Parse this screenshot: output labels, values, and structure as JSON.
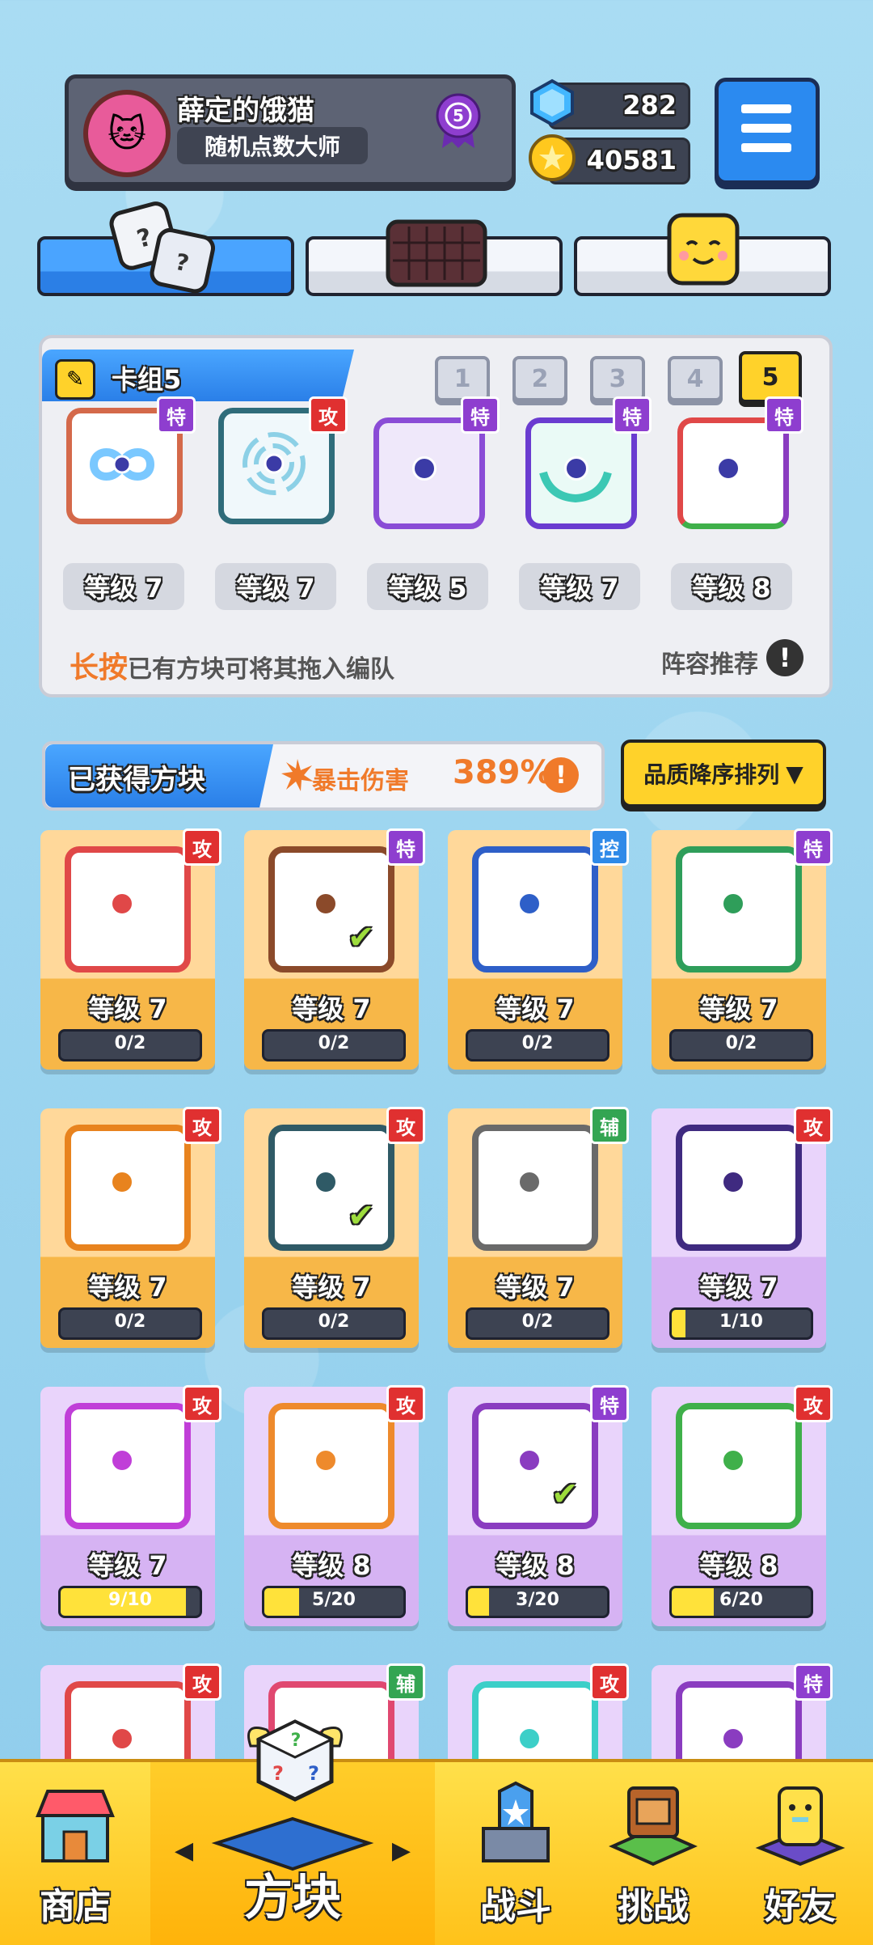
{
  "profile": {
    "username": "薛定的饿猫",
    "title": "随机点数大师",
    "rank": "5"
  },
  "currency": {
    "gems": "282",
    "coins": "40581"
  },
  "top_tabs": [
    {
      "id": "dice",
      "active": true
    },
    {
      "id": "board",
      "active": false
    },
    {
      "id": "emote",
      "active": false
    }
  ],
  "deck": {
    "title": "卡组5",
    "numbers": [
      "1",
      "2",
      "3",
      "4",
      "5"
    ],
    "active_number": "5",
    "slots": [
      {
        "tag": "特",
        "level": "等级 7",
        "icon": "rainbow-infinity-dice"
      },
      {
        "tag": "攻",
        "level": "等级 7",
        "icon": "vortex-dice"
      },
      {
        "tag": "特",
        "level": "等级 5",
        "icon": "crack-dice"
      },
      {
        "tag": "特",
        "level": "等级 7",
        "icon": "hands-dice"
      },
      {
        "tag": "特",
        "level": "等级 8",
        "icon": "rainbow-prism-dice"
      }
    ],
    "hint_highlight": "长按",
    "hint_rest": "已有方块可将其拖入编队",
    "recommend_label": "阵容推荐"
  },
  "obtained": {
    "title": "已获得方块",
    "crit_label": "暴击伤害",
    "crit_value": "389%",
    "sort_label": "品质降序排列"
  },
  "cards": [
    {
      "tag": "攻",
      "tag_type": "gong",
      "level": "等级 7",
      "progress": "0/2",
      "fill": 0,
      "rarity": "gold",
      "icon": "star-burst-dice",
      "color": "#e04848",
      "checked": false
    },
    {
      "tag": "特",
      "tag_type": "te",
      "level": "等级 7",
      "progress": "0/2",
      "fill": 0,
      "rarity": "gold",
      "icon": "infinity-dice",
      "color": "#8b4a2a",
      "checked": true
    },
    {
      "tag": "控",
      "tag_type": "kong",
      "level": "等级 7",
      "progress": "0/2",
      "fill": 0,
      "rarity": "gold",
      "icon": "snowflake-dice",
      "color": "#2e5fc8",
      "checked": false
    },
    {
      "tag": "特",
      "tag_type": "te",
      "level": "等级 7",
      "progress": "0/2",
      "fill": 0,
      "rarity": "gold",
      "icon": "pentagram-dice",
      "color": "#2f9e5a",
      "checked": false
    },
    {
      "tag": "攻",
      "tag_type": "gong",
      "level": "等级 7",
      "progress": "0/2",
      "fill": 0,
      "rarity": "gold",
      "icon": "fire-swirl-dice",
      "color": "#e8831e",
      "checked": false
    },
    {
      "tag": "攻",
      "tag_type": "gong",
      "level": "等级 7",
      "progress": "0/2",
      "fill": 0,
      "rarity": "gold",
      "icon": "dark-vortex-dice",
      "color": "#2f5a66",
      "checked": true
    },
    {
      "tag": "辅",
      "tag_type": "fu",
      "level": "等级 7",
      "progress": "0/2",
      "fill": 0,
      "rarity": "gold",
      "icon": "clock-dice",
      "color": "#6a6a6a",
      "checked": false
    },
    {
      "tag": "攻",
      "tag_type": "gong",
      "level": "等级 7",
      "progress": "1/10",
      "fill": 0.1,
      "rarity": "purple",
      "icon": "scythe-dice",
      "color": "#3f2a80",
      "checked": false
    },
    {
      "tag": "攻",
      "tag_type": "gong",
      "level": "等级 7",
      "progress": "9/10",
      "fill": 0.9,
      "rarity": "purple",
      "icon": "pixel-dice",
      "color": "#c03ed8",
      "checked": false
    },
    {
      "tag": "攻",
      "tag_type": "gong",
      "level": "等级 8",
      "progress": "5/20",
      "fill": 0.25,
      "rarity": "purple",
      "icon": "target-dice",
      "color": "#ee8a2c",
      "checked": false
    },
    {
      "tag": "特",
      "tag_type": "te",
      "level": "等级 8",
      "progress": "3/20",
      "fill": 0.15,
      "rarity": "purple",
      "icon": "rainbow-dice",
      "color": "#8a3cc0",
      "checked": true
    },
    {
      "tag": "攻",
      "tag_type": "gong",
      "level": "等级 8",
      "progress": "6/20",
      "fill": 0.3,
      "rarity": "purple",
      "icon": "biohazard-dice",
      "color": "#3fb04a",
      "checked": false
    },
    {
      "tag": "攻",
      "tag_type": "gong",
      "rarity": "purple",
      "icon": "lightning-dice",
      "color": "#e04848"
    },
    {
      "tag": "辅",
      "tag_type": "fu",
      "rarity": "purple",
      "icon": "cross-dice",
      "color": "#e04870"
    },
    {
      "tag": "攻",
      "tag_type": "gong",
      "rarity": "purple",
      "icon": "wave-dice",
      "color": "#3ccfc8"
    },
    {
      "tag": "特",
      "tag_type": "te",
      "rarity": "purple",
      "icon": "arrow-dice",
      "color": "#8a3cc0"
    }
  ],
  "nav": {
    "shop": "商店",
    "dice": "方块",
    "battle": "战斗",
    "challenge": "挑战",
    "friends": "好友"
  },
  "colors": {
    "accent_blue": "#2b8af0",
    "gold": "#ffd22a",
    "orange": "#f07a2a"
  }
}
